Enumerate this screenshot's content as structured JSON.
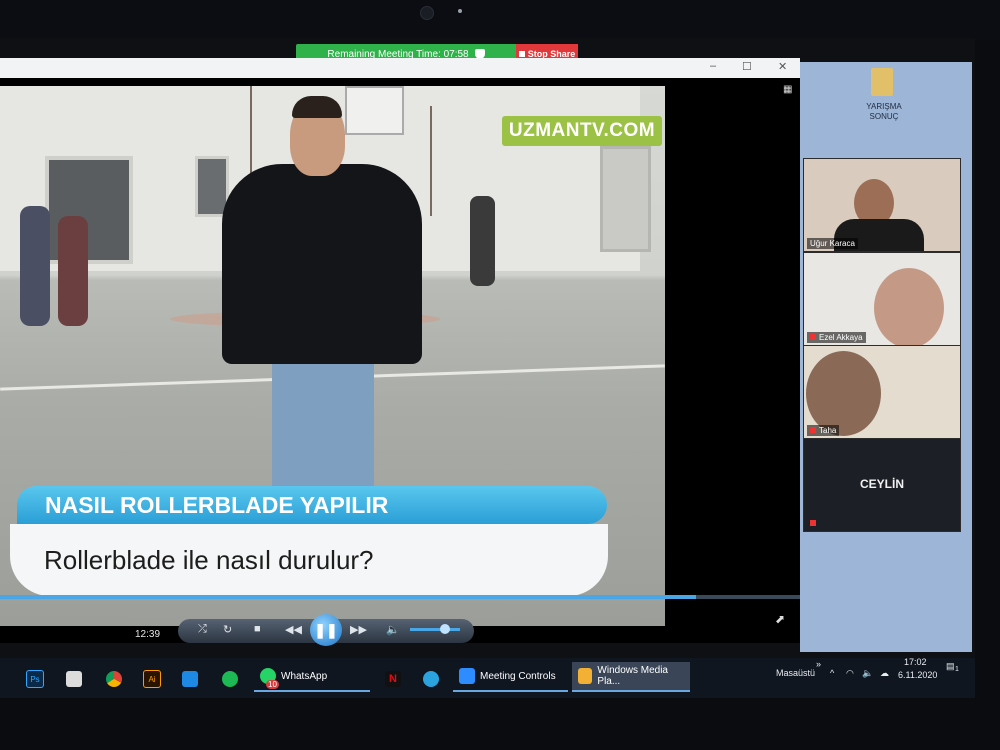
{
  "meeting": {
    "remaining_time": "Remaining Meeting Time: 07:58",
    "stop_share": "Stop Share"
  },
  "video": {
    "logo": "UZMANTV.COM",
    "banner_title": "NASIL ROLLERBLADE YAPILIR",
    "banner_subtitle": "Rollerblade ile nasıl durulur?"
  },
  "player": {
    "time": "12:39",
    "progress": 0.87,
    "volume": 0.7
  },
  "desktop": {
    "icon_label": "YARIŞMA SONUÇ"
  },
  "participants": [
    {
      "name": "Uğur Karaca",
      "muted": false
    },
    {
      "name": "Ezel Akkaya",
      "muted": true
    },
    {
      "name": "Taha",
      "muted": true
    },
    {
      "name": "CEYLİN",
      "muted": true
    }
  ],
  "taskbar": {
    "apps": [
      {
        "label": "WhatsApp",
        "badge": "10"
      },
      {
        "label": "Meeting Controls"
      },
      {
        "label": "Windows Media Pla..."
      }
    ],
    "desktop_label": "Masaüstü",
    "clock_time": "17:02",
    "clock_date": "6.11.2020",
    "notification_count": "1"
  },
  "colors": {
    "share_green": "#2fb24a",
    "stop_red": "#e0383b",
    "banner_blue": "#2a9ed6",
    "logo_green": "#9bc244"
  }
}
